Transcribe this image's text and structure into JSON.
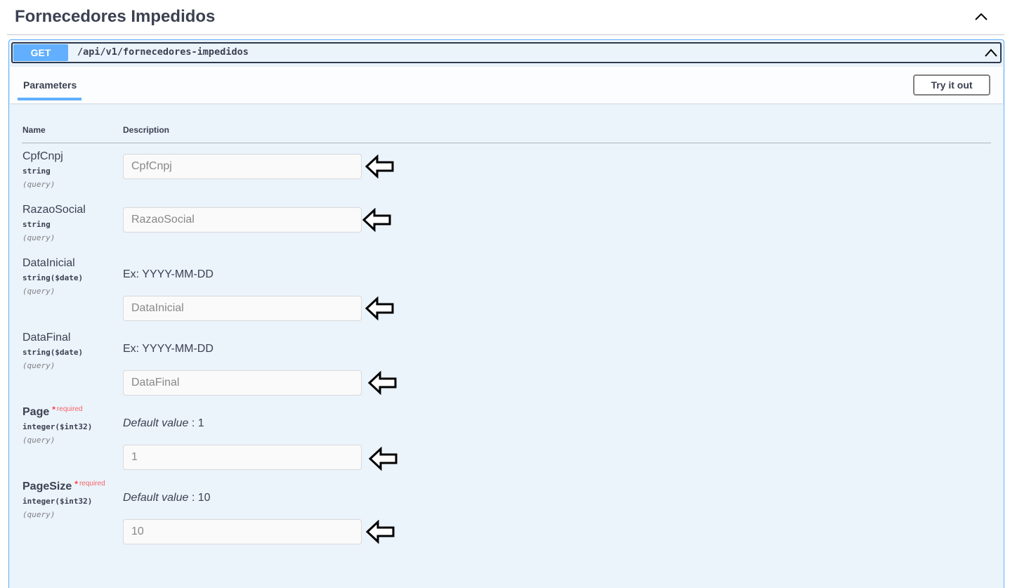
{
  "tag": {
    "title": "Fornecedores Impedidos"
  },
  "operation": {
    "method": "GET",
    "path": "/api/v1/fornecedores-impedidos",
    "method_color": "#61affe"
  },
  "tabs": {
    "parameters_label": "Parameters",
    "try_button_label": "Try it out"
  },
  "table": {
    "name_header": "Name",
    "description_header": "Description"
  },
  "params": [
    {
      "name": "CpfCnpj",
      "type": "string",
      "in": "(query)",
      "example": "",
      "placeholder": "CpfCnpj"
    },
    {
      "name": "RazaoSocial",
      "type": "string",
      "in": "(query)",
      "example": "",
      "placeholder": "RazaoSocial"
    },
    {
      "name": "DataInicial",
      "type": "string($date)",
      "in": "(query)",
      "example": "Ex: YYYY-MM-DD",
      "placeholder": "DataInicial"
    },
    {
      "name": "DataFinal",
      "type": "string($date)",
      "in": "(query)",
      "example": "Ex: YYYY-MM-DD",
      "placeholder": "DataFinal"
    },
    {
      "name": "Page",
      "required_star": "*",
      "required_text": "required",
      "type": "integer($int32)",
      "in": "(query)",
      "default_label": "Default value",
      "default_sep": " : ",
      "default_value": "1",
      "placeholder": "1"
    },
    {
      "name": "PageSize",
      "required_star": "*",
      "required_text": "required",
      "type": "integer($int32)",
      "in": "(query)",
      "default_label": "Default value",
      "default_sep": " : ",
      "default_value": "10",
      "placeholder": "10"
    }
  ]
}
